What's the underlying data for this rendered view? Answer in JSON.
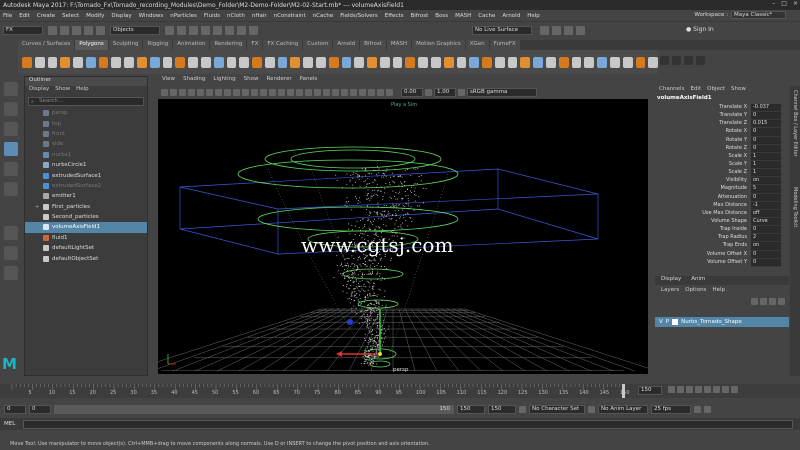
{
  "window": {
    "title": "Autodesk Maya 2017: F:\\Tornado_Fx\\Tornado_recording_Modules\\Demo_Folder\\M2-Demo-Folder\\M2-02-Start.mb*  ---  volumeAxisField1"
  },
  "menubar": {
    "items": [
      "File",
      "Edit",
      "Create",
      "Select",
      "Modify",
      "Display",
      "Windows",
      "nParticles",
      "Fluids",
      "nCloth",
      "nHair",
      "nConstraint",
      "nCache",
      "Fields/Solvers",
      "Effects",
      "Bifrost",
      "Boss",
      "MASH",
      "Cache",
      "Arnold",
      "Help"
    ],
    "workspace_label": "Workspace :",
    "workspace_value": "Maya Classic*"
  },
  "statusline": {
    "mode": "FX",
    "selection_mode": "Objects",
    "live_surface": "No Live Surface",
    "sign_in": "Sign In"
  },
  "shelf": {
    "tabs": [
      "Curves / Surfaces",
      "Polygons",
      "Sculpting",
      "Rigging",
      "Animation",
      "Rendering",
      "FX",
      "FX Caching",
      "Custom",
      "Arnold",
      "Bifrost",
      "MASH",
      "Motion Graphics",
      "XGen",
      "FumeFX"
    ],
    "active_tab": "Polygons"
  },
  "outliner": {
    "title": "Outliner",
    "menu": [
      "Display",
      "Show",
      "Help"
    ],
    "search_placeholder": "Search...",
    "items": [
      {
        "label": "persp",
        "dim": true,
        "icon": "camera-icon",
        "color": "#6a7a8a"
      },
      {
        "label": "top",
        "dim": true,
        "icon": "camera-icon",
        "color": "#6a7a8a"
      },
      {
        "label": "front",
        "dim": true,
        "icon": "camera-icon",
        "color": "#6a7a8a"
      },
      {
        "label": "side",
        "dim": true,
        "icon": "camera-icon",
        "color": "#6a7a8a"
      },
      {
        "label": "nurbs1",
        "dim": true,
        "icon": "curve-icon",
        "color": "#6a8aa8"
      },
      {
        "label": "nurbsCircle1",
        "dim": false,
        "icon": "curve-icon",
        "color": "#8aa8c8"
      },
      {
        "label": "extrudedSurface1",
        "dim": false,
        "icon": "surface-icon",
        "color": "#4a90d8"
      },
      {
        "label": "extrudedSurface2",
        "dim": true,
        "icon": "surface-icon",
        "color": "#4a90d8"
      },
      {
        "label": "emitter1",
        "dim": false,
        "icon": "emitter-icon",
        "color": "#a8a8a8"
      },
      {
        "label": "First_particles",
        "dim": false,
        "icon": "particle-icon",
        "color": "#c8c8c8",
        "expand": "+"
      },
      {
        "label": "Second_particles",
        "dim": false,
        "icon": "particle-icon",
        "color": "#c8c8c8"
      },
      {
        "label": "volumeAxisField1",
        "dim": false,
        "icon": "field-icon",
        "color": "#d8e8f8",
        "selected": true
      },
      {
        "label": "fluid1",
        "dim": false,
        "icon": "fluid-icon",
        "color": "#c86a3a"
      },
      {
        "label": "defaultLightSet",
        "dim": false,
        "icon": "set-icon",
        "color": "#c8c8c8"
      },
      {
        "label": "defaultObjectSet",
        "dim": false,
        "icon": "set-icon",
        "color": "#c8c8c8"
      }
    ]
  },
  "viewport": {
    "menu": [
      "View",
      "Shading",
      "Lighting",
      "Show",
      "Renderer",
      "Panels"
    ],
    "exposure": "0.00",
    "gamma": "1.00",
    "color_space": "sRGB gamma",
    "camera_label": "Play a Sim",
    "camera_name": "persp",
    "watermark": "www.cgtsj.com"
  },
  "channelbox": {
    "menu": [
      "Channels",
      "Edit",
      "Object",
      "Show"
    ],
    "node": "volumeAxisField1",
    "rows": [
      {
        "label": "Translate X",
        "value": "-0.037"
      },
      {
        "label": "Translate Y",
        "value": "0"
      },
      {
        "label": "Translate Z",
        "value": "0.015"
      },
      {
        "label": "Rotate X",
        "value": "0"
      },
      {
        "label": "Rotate Y",
        "value": "0"
      },
      {
        "label": "Rotate Z",
        "value": "0"
      },
      {
        "label": "Scale X",
        "value": "1"
      },
      {
        "label": "Scale Y",
        "value": "1"
      },
      {
        "label": "Scale Z",
        "value": "1"
      },
      {
        "label": "Visibility",
        "value": "on"
      },
      {
        "label": "Magnitude",
        "value": "5"
      },
      {
        "label": "Attenuation",
        "value": "0"
      },
      {
        "label": "Max Distance",
        "value": "-1"
      },
      {
        "label": "Use Max Distance",
        "value": "off"
      },
      {
        "label": "Volume Shape",
        "value": "Curve"
      },
      {
        "label": "Trap Inside",
        "value": "0"
      },
      {
        "label": "Trap Radius",
        "value": "2"
      },
      {
        "label": "Trap Ends",
        "value": "on"
      },
      {
        "label": "Volume Offset X",
        "value": "0"
      },
      {
        "label": "Volume Offset Y",
        "value": "0"
      }
    ]
  },
  "layereditor": {
    "tabs": [
      "Display",
      "Anim"
    ],
    "menu": [
      "Layers",
      "Options",
      "Help"
    ],
    "layer_v": "V",
    "layer_p": "P",
    "layer_name": "Nurbs_Tornado_Shape"
  },
  "side_tabs": [
    "Channel Box / Layer Editor",
    "Modeling Toolkit"
  ],
  "timeline": {
    "ticks": [
      "5",
      "10",
      "15",
      "20",
      "25",
      "30",
      "35",
      "40",
      "45",
      "50",
      "55",
      "60",
      "65",
      "70",
      "75",
      "80",
      "85",
      "90",
      "95",
      "100",
      "105",
      "110",
      "115",
      "120",
      "125",
      "130",
      "135",
      "140",
      "145",
      "150"
    ],
    "current_frame": "150"
  },
  "range": {
    "start": "0",
    "inner_start": "0",
    "inner_end": "150",
    "end_a": "150",
    "end_b": "150",
    "character_set": "No Character Set",
    "anim_layer": "No Anim Layer",
    "fps": "25 fps"
  },
  "cmdline": {
    "label": "MEL"
  },
  "helpline": {
    "text": "Move Tool: Use manipulator to move object(s). Ctrl+MMB+drag to move components along normals. Use D or INSERT to change the pivot position and axis orientation."
  },
  "logo": {
    "letter": "M"
  },
  "colors": {
    "accent": "#5285a6",
    "viewport_bg": "#000000",
    "field_green": "#5fdc5f",
    "particles": "#cfcfcf"
  }
}
